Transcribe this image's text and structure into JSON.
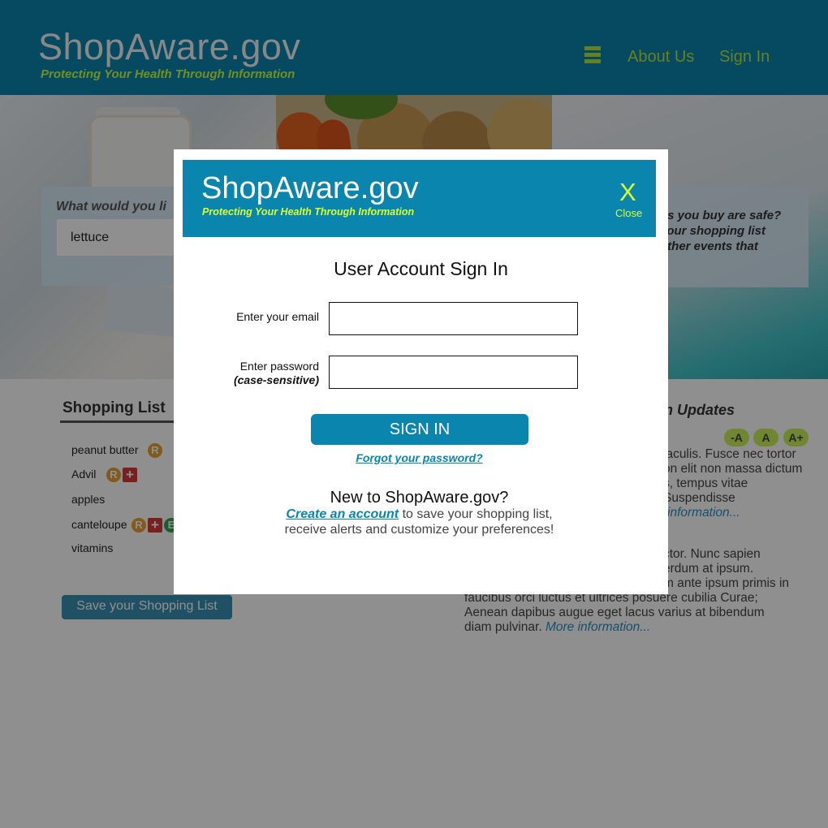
{
  "colors": {
    "brand_blue": "#0a85ad",
    "accent_green": "#c9ff3c",
    "overlay": "rgba(0,0,0,0.44)"
  },
  "header": {
    "logo_title": "ShopAware.gov",
    "logo_tagline": "Protecting Your Health Through Information",
    "menu_icon": "hamburger-menu-icon",
    "nav": {
      "about": "About Us",
      "signin": "Sign In"
    }
  },
  "search": {
    "question": "What would you li",
    "value": "lettuce"
  },
  "info_panel": {
    "text_lines": [
      "ns you buy are safe?",
      "your shopping list",
      "other events that",
      "."
    ]
  },
  "shopping_list": {
    "title": "Shopping List",
    "items": [
      {
        "name": "peanut butter",
        "badges": [
          "R"
        ]
      },
      {
        "name": "Advil",
        "badges": [
          "R",
          "+"
        ]
      },
      {
        "name": "apples",
        "badges": []
      },
      {
        "name": "canteloupe",
        "badges": [
          "R",
          "+",
          "E"
        ]
      },
      {
        "name": "vitamins",
        "badges": []
      }
    ],
    "save_label": "Save your Shopping List"
  },
  "updates": {
    "title": "n Updates",
    "font_controls": [
      "-A",
      "A",
      "A+"
    ],
    "block1_lines": [
      "iaculis. Fusce nec tortor",
      "on elit non massa dictum",
      "s, tempus vitae",
      "Suspendisse"
    ],
    "block1_more": "information...",
    "block2_lines": [
      "ctor. Nunc sapien",
      "erdum at ipsum.",
      "m ante ipsum primis in",
      "faucibus orci luctus et ultrices posuere cubilia Curae;",
      "Aenean dapibus augue eget lacus varius at bibendum"
    ],
    "block2_last": "diam pulvinar.",
    "block2_more": "More information..."
  },
  "modal": {
    "logo_title": "ShopAware.gov",
    "logo_tagline": "Protecting Your Health Through Information",
    "close_x": "X",
    "close_label": "Close",
    "title": "User Account Sign In",
    "email_label": "Enter your email",
    "password_label": "Enter password",
    "password_note": "(case-sensitive)",
    "signin_button": "SIGN IN",
    "forgot_link": "Forgot your password?",
    "new_title": "New to ShopAware.gov?",
    "create_link": "Create an account",
    "create_text_1": " to save your shopping list,",
    "create_text_2": "receive alerts and customize your preferences!"
  }
}
